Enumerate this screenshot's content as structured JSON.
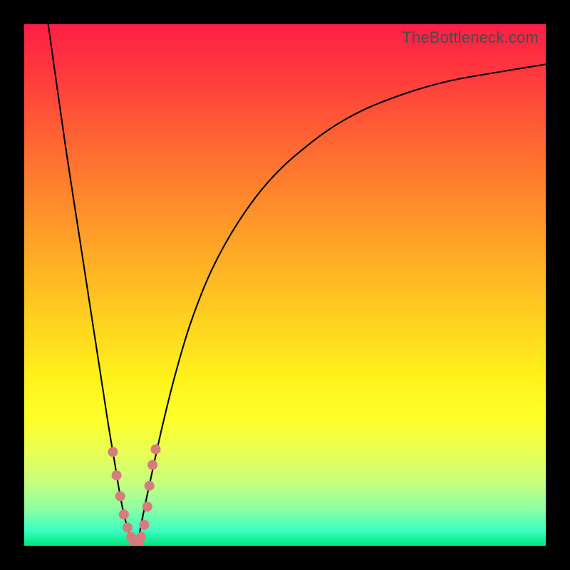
{
  "attribution": "TheBottleneck.com",
  "chart_data": {
    "type": "line",
    "title": "",
    "xlabel": "",
    "ylabel": "",
    "xlim": [
      0,
      100
    ],
    "ylim": [
      0,
      100
    ],
    "grid": false,
    "legend": false,
    "series": [
      {
        "name": "left-branch",
        "x": [
          4.6,
          6,
          8,
          10,
          12,
          14,
          16,
          17.5,
          18.5,
          19.5,
          20.5,
          21.2
        ],
        "y": [
          100,
          90,
          76,
          63,
          50,
          37,
          24,
          15,
          9,
          4.5,
          1.5,
          0
        ]
      },
      {
        "name": "right-branch",
        "x": [
          21.2,
          22,
          23,
          24.5,
          26.5,
          29,
          32,
          36,
          41,
          47,
          54,
          62,
          71,
          81,
          92,
          100
        ],
        "y": [
          0,
          2,
          7,
          14,
          23,
          33,
          43,
          53,
          62,
          70,
          76.5,
          82,
          86,
          89,
          91,
          92.3
        ]
      }
    ],
    "markers": {
      "name": "highlight-dots",
      "color": "#d77c7c",
      "points": [
        {
          "x": 17.0,
          "y": 18.0
        },
        {
          "x": 17.7,
          "y": 13.5
        },
        {
          "x": 18.4,
          "y": 9.5
        },
        {
          "x": 19.1,
          "y": 6.0
        },
        {
          "x": 19.8,
          "y": 3.5
        },
        {
          "x": 20.5,
          "y": 1.7
        },
        {
          "x": 21.2,
          "y": 0.5
        },
        {
          "x": 21.9,
          "y": 0.4
        },
        {
          "x": 22.4,
          "y": 1.7
        },
        {
          "x": 23.0,
          "y": 4.0
        },
        {
          "x": 23.6,
          "y": 7.5
        },
        {
          "x": 24.0,
          "y": 11.5
        },
        {
          "x": 24.6,
          "y": 15.5
        },
        {
          "x": 25.2,
          "y": 18.5
        }
      ]
    },
    "background_gradient": {
      "top": "#ff1e46",
      "bottom": "#00e67a"
    }
  }
}
